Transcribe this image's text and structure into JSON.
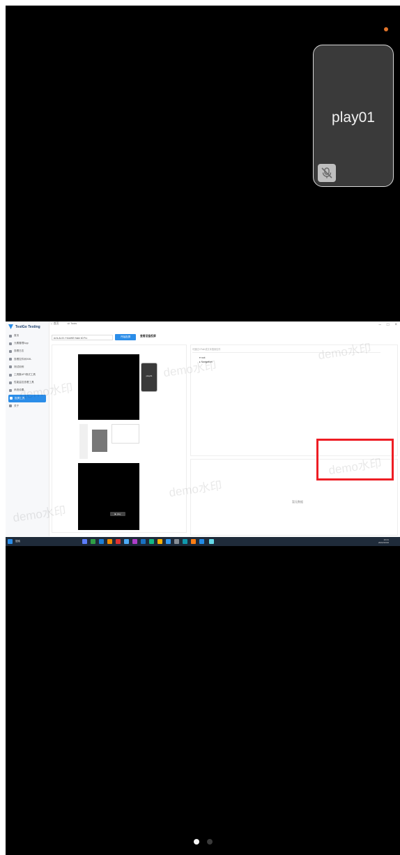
{
  "float_window": {
    "label": "play01",
    "mic_icon": "mic-muted-icon"
  },
  "embedded_app": {
    "brand": "TestGo Testing",
    "menu": [
      {
        "label": "首页"
      },
      {
        "label": "元素管理App"
      },
      {
        "label": "查看日志"
      },
      {
        "label": "查看控件树XML"
      },
      {
        "label": "测试用例"
      },
      {
        "label": "工具集API测试工具"
      },
      {
        "label": "性能监控查看工具"
      },
      {
        "label": "系统设置"
      },
      {
        "label": "投屏工具",
        "active": true
      },
      {
        "label": "关于"
      }
    ],
    "tabs": [
      "← 首页",
      "UI Tools"
    ],
    "device_select": "ALN-AL00 / HUAWEI Mate 60 Pro",
    "connect_button": "开始投屏",
    "side_link": "查看设备投屏",
    "search_placeholder": "可通过XPath或文本搜索控件",
    "tree_items": [
      "▾ root",
      "  ▸ Navigation"
    ],
    "bottom_empty_text": "暂无数据",
    "watermark_text": "demo水印",
    "mini_card_label": "play01",
    "mini_play_label": "▶ play",
    "taskbar_search": "搜索",
    "clock_time": "16:21",
    "clock_date": "2024/10/16",
    "accent_color": "#2b8de8"
  },
  "pager": {
    "count": 2,
    "active_index": 0
  }
}
